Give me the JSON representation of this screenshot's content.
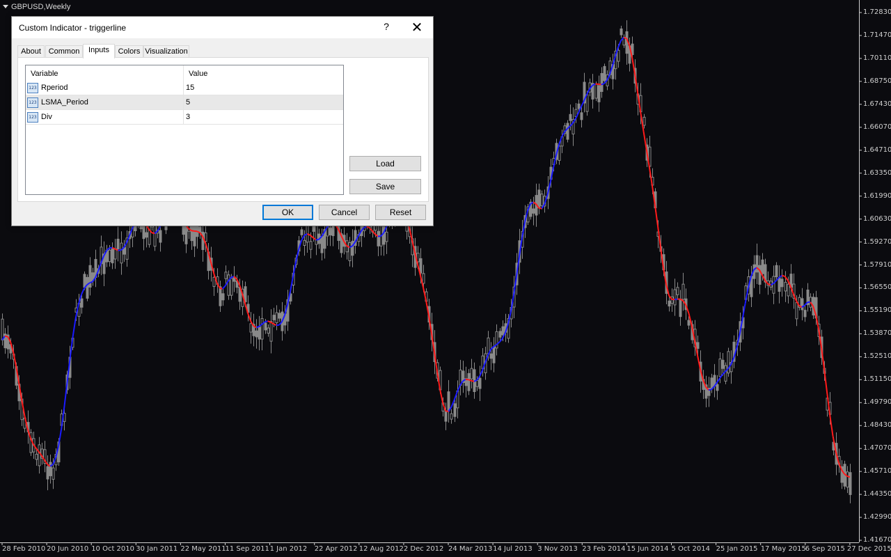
{
  "chart": {
    "title": "GBPUSD,Weekly",
    "y_ticks": [
      "1.72830",
      "1.71470",
      "1.70110",
      "1.68750",
      "1.67430",
      "1.66070",
      "1.64710",
      "1.63350",
      "1.61990",
      "1.60630",
      "1.59270",
      "1.57910",
      "1.56550",
      "1.55190",
      "1.53870",
      "1.52510",
      "1.51150",
      "1.49790",
      "1.48430",
      "1.47070",
      "1.45710",
      "1.44350",
      "1.42990",
      "1.41670"
    ],
    "x_ticks": [
      "28 Feb 2010",
      "20 Jun 2010",
      "10 Oct 2010",
      "30 Jan 2011",
      "22 May 2011",
      "11 Sep 2011",
      "1 Jan 2012",
      "22 Apr 2012",
      "12 Aug 2012",
      "2 Dec 2012",
      "24 Mar 2013",
      "14 Jul 2013",
      "3 Nov 2013",
      "23 Feb 2014",
      "15 Jun 2014",
      "5 Oct 2014",
      "25 Jan 2015",
      "17 May 2015",
      "6 Sep 2015",
      "27 Dec 2015"
    ],
    "colors": {
      "background": "#0b0b0f",
      "candles": "#8a8a8a",
      "trigger_up": "#1a1aff",
      "trigger_down": "#ff1a1a",
      "text": "#cfcfcf"
    }
  },
  "chart_data": {
    "type": "line",
    "title": "",
    "xlabel": "",
    "ylabel": "",
    "ylim": [
      1.4167,
      1.7283
    ],
    "x": [
      "28 Feb 2010",
      "20 Jun 2010",
      "10 Oct 2010",
      "30 Jan 2011",
      "22 May 2011",
      "11 Sep 2011",
      "1 Jan 2012",
      "22 Apr 2012",
      "12 Aug 2012",
      "2 Dec 2012",
      "24 Mar 2013",
      "14 Jul 2013",
      "3 Nov 2013",
      "23 Feb 2014",
      "15 Jun 2014",
      "5 Oct 2014",
      "25 Jan 2015",
      "17 May 2015",
      "6 Sep 2015",
      "27 Dec 2015"
    ],
    "series": [
      {
        "values": [
          1.535,
          1.458,
          1.575,
          1.6,
          1.61,
          1.57,
          1.54,
          1.6,
          1.595,
          1.61,
          1.498,
          1.525,
          1.617,
          1.675,
          1.708,
          1.565,
          1.505,
          1.575,
          1.56,
          1.448
        ]
      }
    ]
  },
  "dialog": {
    "title": "Custom Indicator - triggerline",
    "help_label": "?",
    "close_label": "✕",
    "tabs": [
      {
        "label": "About"
      },
      {
        "label": "Common"
      },
      {
        "label": "Inputs"
      },
      {
        "label": "Colors"
      },
      {
        "label": "Visualization"
      }
    ],
    "active_tab": "Inputs",
    "grid": {
      "col_variable": "Variable",
      "col_value": "Value",
      "rows": [
        {
          "icon": "123",
          "name": "Rperiod",
          "value": "15"
        },
        {
          "icon": "123",
          "name": "LSMA_Period",
          "value": "5"
        },
        {
          "icon": "123",
          "name": "Div",
          "value": "3"
        }
      ]
    },
    "buttons": {
      "load": "Load",
      "save": "Save",
      "ok": "OK",
      "cancel": "Cancel",
      "reset": "Reset"
    }
  }
}
